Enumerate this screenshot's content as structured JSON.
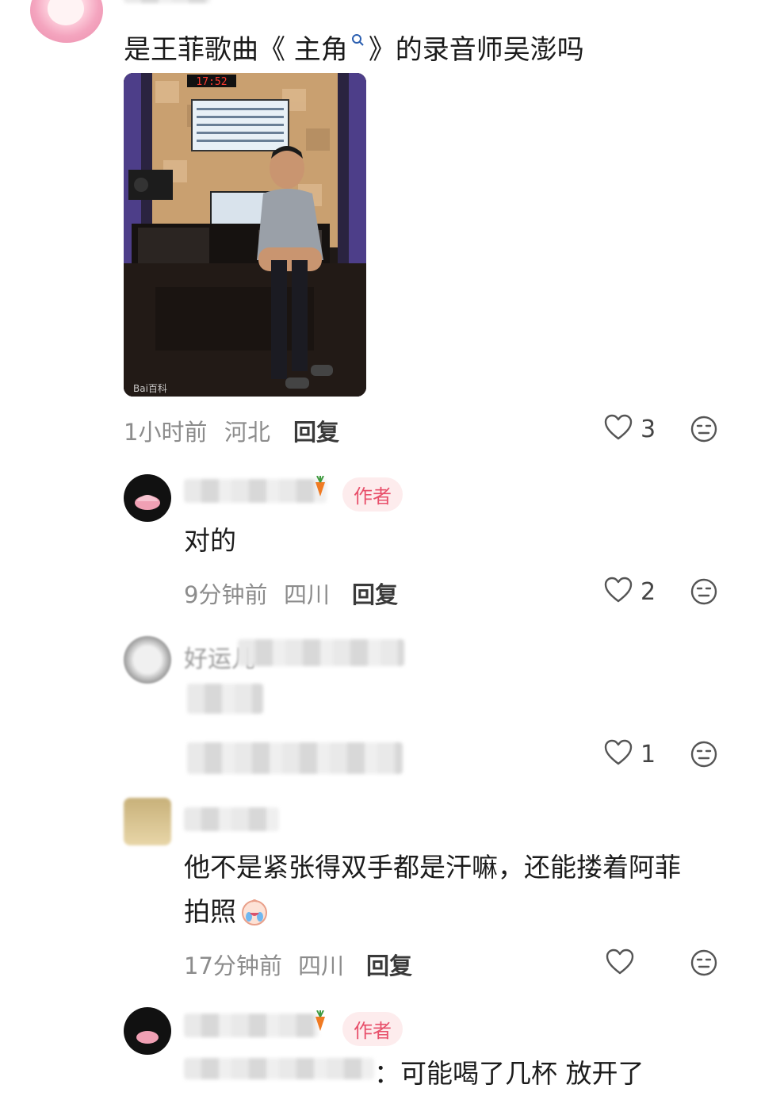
{
  "post": {
    "question": "是王菲歌曲《 主角",
    "question_end": "》的录音师吴澎吗",
    "photo": {
      "clock": "17:52",
      "watermark": "Bai百科"
    },
    "time": "1小时前",
    "location": "河北",
    "reply_label": "回复",
    "likes": "3"
  },
  "comments": [
    {
      "badge": "作者",
      "text": "对的",
      "time": "9分钟前",
      "location": "四川",
      "reply_label": "回复",
      "likes": "2"
    },
    {
      "text_visible_fragment": "好运儿",
      "likes": "1"
    },
    {
      "text_line1": "他不是紧张得双手都是汗嘛，还能搂着阿菲",
      "text_line2": "拍照",
      "time": "17分钟前",
      "location": "四川",
      "reply_label": "回复",
      "likes": ""
    },
    {
      "badge": "作者",
      "text_partial": "：可能喝了几杯 放开了"
    }
  ],
  "colors": {
    "badge_text": "#e8506b",
    "badge_bg": "#fdeced",
    "meta_text": "#8c8c8c"
  }
}
